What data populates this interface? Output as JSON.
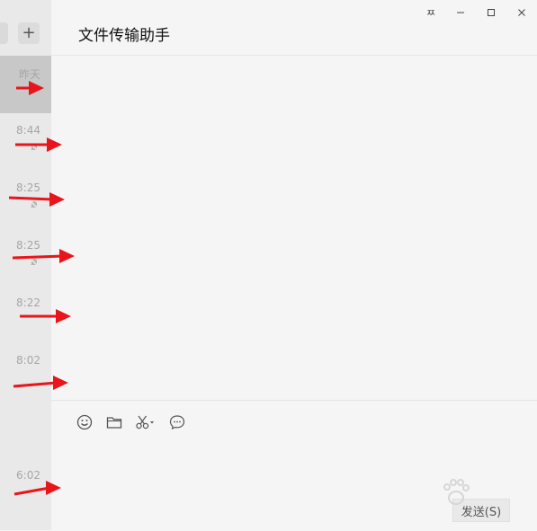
{
  "window": {
    "title": "文件传输助手",
    "pin_glyph": "ㅉ"
  },
  "chat_list": {
    "new_chat_glyph": "+",
    "rows": [
      {
        "time": "昨天",
        "muted": false,
        "active": true
      },
      {
        "time": "8:44",
        "muted": true,
        "active": false
      },
      {
        "time": "8:25",
        "muted": true,
        "active": false
      },
      {
        "time": "8:25",
        "muted": true,
        "active": false
      },
      {
        "time": "8:22",
        "muted": false,
        "active": false
      },
      {
        "time": "8:02",
        "muted": false,
        "active": false
      },
      {
        "time": "",
        "muted": false,
        "active": false
      },
      {
        "time": "6:02",
        "muted": false,
        "active": false
      }
    ]
  },
  "composer": {
    "tools": [
      "emoji-icon",
      "folder-icon",
      "scissors-icon",
      "chat-bubble-icon"
    ],
    "send_label": "发送(S)"
  },
  "colors": {
    "accent_red": "#e8151b"
  }
}
